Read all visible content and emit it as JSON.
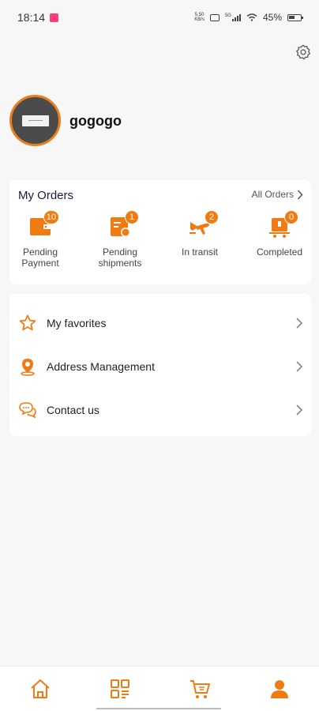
{
  "status_bar": {
    "time": "18:14",
    "speed": "5.50\nKB/s",
    "network": "5G",
    "battery": "45%"
  },
  "profile": {
    "username": "gogogo"
  },
  "orders": {
    "title": "My Orders",
    "all_orders_label": "All Orders",
    "items": [
      {
        "label": "Pending\nPayment",
        "badge": "10",
        "icon": "wallet-icon"
      },
      {
        "label": "Pending\nshipments",
        "badge": "1",
        "icon": "package-icon"
      },
      {
        "label": "In transit",
        "badge": "2",
        "icon": "plane-icon"
      },
      {
        "label": "Completed",
        "badge": "0",
        "icon": "cart-check-icon"
      }
    ]
  },
  "menu": {
    "items": [
      {
        "label": "My favorites",
        "icon": "star-icon"
      },
      {
        "label": "Address Management",
        "icon": "location-pin-icon"
      },
      {
        "label": "Contact us",
        "icon": "chat-icon"
      }
    ]
  },
  "bottom_nav": [
    {
      "name": "home",
      "icon": "home-icon"
    },
    {
      "name": "category",
      "icon": "category-icon"
    },
    {
      "name": "cart",
      "icon": "cart-icon"
    },
    {
      "name": "profile",
      "icon": "person-icon",
      "active": true
    }
  ],
  "colors": {
    "accent": "#f07b12",
    "background": "#f7f7f7",
    "card": "#ffffff"
  }
}
